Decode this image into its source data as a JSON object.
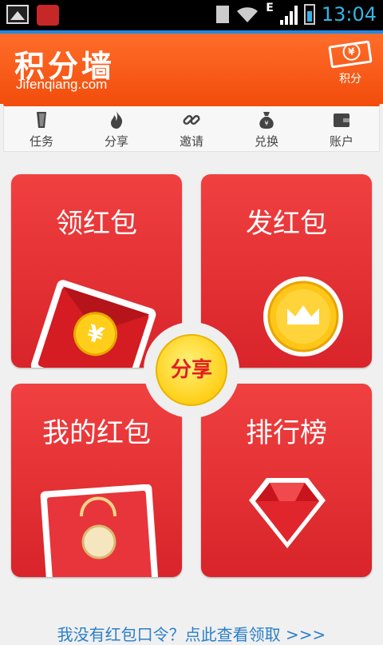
{
  "status_bar": {
    "time": "13:04",
    "network": "E"
  },
  "header": {
    "logo": "积分墙",
    "subtitle": "Jifenqiang.com",
    "points_label": "积分"
  },
  "nav": {
    "items": [
      {
        "label": "任务",
        "icon": "task-icon"
      },
      {
        "label": "分享",
        "icon": "flame-icon"
      },
      {
        "label": "邀请",
        "icon": "link-icon"
      },
      {
        "label": "兑换",
        "icon": "money-bag-icon"
      },
      {
        "label": "账户",
        "icon": "wallet-icon"
      }
    ]
  },
  "tiles": {
    "receive": {
      "title": "领红包"
    },
    "send": {
      "title": "发红包"
    },
    "mine": {
      "title": "我的红包"
    },
    "ranking": {
      "title": "排行榜"
    }
  },
  "share_button": {
    "label": "分享"
  },
  "footer": {
    "link": "我没有红包口令？点此查看领取 >>>"
  },
  "colors": {
    "header": "#f24d0c",
    "tile": "#e0282e",
    "link": "#2a7fc9",
    "share": "#ffcf18"
  }
}
